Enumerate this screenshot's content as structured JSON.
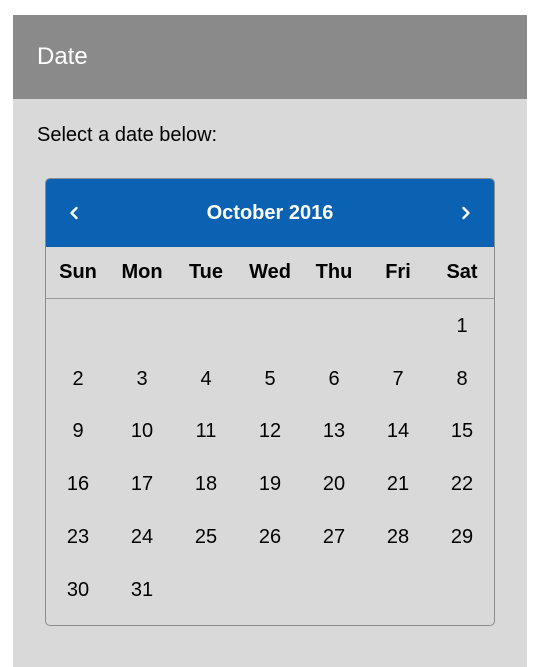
{
  "panel": {
    "title": "Date",
    "prompt": "Select a date below:"
  },
  "calendar": {
    "month_label": "October 2016",
    "prev_icon": "chevron-left-icon",
    "next_icon": "chevron-right-icon",
    "weekdays": [
      "Sun",
      "Mon",
      "Tue",
      "Wed",
      "Thu",
      "Fri",
      "Sat"
    ],
    "leading_blanks": 6,
    "days": [
      "1",
      "2",
      "3",
      "4",
      "5",
      "6",
      "7",
      "8",
      "9",
      "10",
      "11",
      "12",
      "13",
      "14",
      "15",
      "16",
      "17",
      "18",
      "19",
      "20",
      "21",
      "22",
      "23",
      "24",
      "25",
      "26",
      "27",
      "28",
      "29",
      "30",
      "31"
    ]
  },
  "colors": {
    "header_bg": "#8a8a8a",
    "panel_bg": "#d9d9d9",
    "calendar_header_bg": "#0b62b3"
  }
}
